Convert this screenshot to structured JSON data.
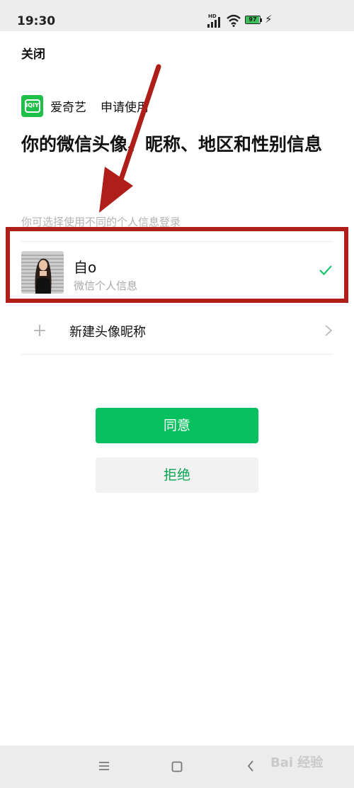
{
  "status_bar": {
    "time": "19:30",
    "hd_label": "HD",
    "battery_level": "97",
    "battery_fraction": 0.97
  },
  "header": {
    "close_label": "关闭"
  },
  "app": {
    "name": "爱奇艺",
    "logo_text": "iQIY",
    "request_text": "申请使用",
    "brand_color": "#1fc04a"
  },
  "title": "你的微信头像、昵称、地区和性别信息",
  "hint": "你可选择使用不同的个人信息登录",
  "profile": {
    "name": "自o",
    "subtitle": "微信个人信息",
    "selected": true
  },
  "new_profile": {
    "label": "新建头像昵称"
  },
  "buttons": {
    "agree_label": "同意",
    "reject_label": "拒绝"
  },
  "colors": {
    "accent": "#07c160",
    "highlight": "#b01e1a"
  },
  "icons": {
    "check": "check-icon",
    "plus": "plus-icon",
    "chevron": "chevron-right-icon"
  },
  "watermark": "Bai 经验"
}
